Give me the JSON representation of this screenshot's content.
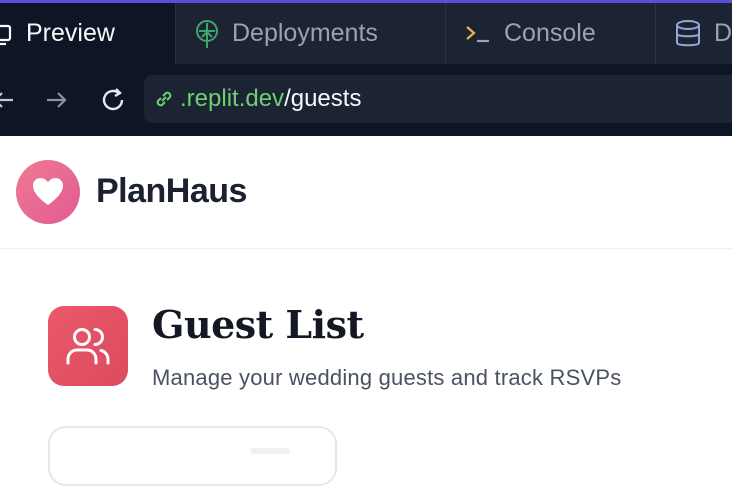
{
  "ide": {
    "tabs": [
      {
        "label": "Preview",
        "icon": "monitor-icon",
        "active": true
      },
      {
        "label": "Deployments",
        "icon": "deployments-icon",
        "active": false
      },
      {
        "label": "Console",
        "icon": "terminal-icon",
        "active": false
      },
      {
        "label": "D",
        "icon": "database-icon",
        "active": false
      }
    ]
  },
  "urlbar": {
    "host": ".replit.dev",
    "path": "/guests"
  },
  "app": {
    "brand": "PlanHaus",
    "logo_icon": "heart-icon"
  },
  "page": {
    "title": "Guest List",
    "subtitle": "Manage your wedding guests and track RSVPs",
    "icon": "users-icon"
  },
  "colors": {
    "ide_bg": "#1c2333",
    "url_host": "#6fcf72",
    "accent": "#e05a6a"
  }
}
